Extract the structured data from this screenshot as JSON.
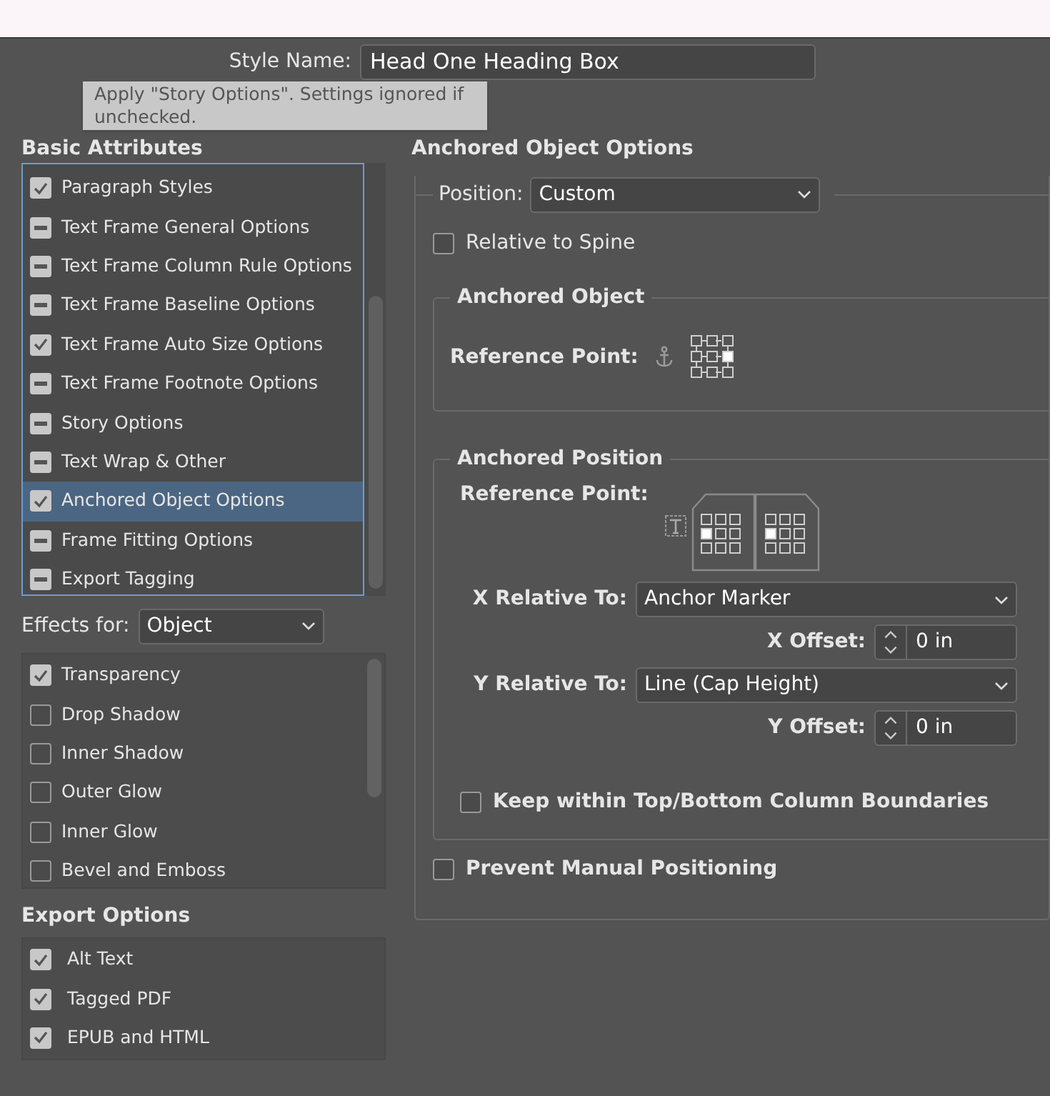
{
  "style_name": {
    "label": "Style Name:",
    "value": "Head One Heading Box"
  },
  "tooltip": "Apply \"Story Options\". Settings ignored if unchecked.",
  "basic_attributes": {
    "title": "Basic Attributes",
    "items": [
      {
        "label": "Paragraph Styles",
        "checked": true,
        "mixed": false,
        "selected": false
      },
      {
        "label": "Text Frame General Options",
        "checked": false,
        "mixed": true,
        "selected": false
      },
      {
        "label": "Text Frame Column Rule Options",
        "checked": false,
        "mixed": true,
        "selected": false
      },
      {
        "label": "Text Frame Baseline Options",
        "checked": false,
        "mixed": true,
        "selected": false
      },
      {
        "label": "Text Frame Auto Size Options",
        "checked": true,
        "mixed": false,
        "selected": false
      },
      {
        "label": "Text Frame Footnote Options",
        "checked": false,
        "mixed": true,
        "selected": false
      },
      {
        "label": "Story Options",
        "checked": false,
        "mixed": true,
        "selected": false
      },
      {
        "label": "Text Wrap & Other",
        "checked": false,
        "mixed": true,
        "selected": false
      },
      {
        "label": "Anchored Object Options",
        "checked": true,
        "mixed": false,
        "selected": true
      },
      {
        "label": "Frame Fitting Options",
        "checked": false,
        "mixed": true,
        "selected": false
      },
      {
        "label": "Export Tagging",
        "checked": false,
        "mixed": true,
        "selected": false
      }
    ]
  },
  "effects_for": {
    "label": "Effects for:",
    "value": "Object"
  },
  "effects": [
    {
      "label": "Transparency",
      "checked": true
    },
    {
      "label": "Drop Shadow",
      "checked": false
    },
    {
      "label": "Inner Shadow",
      "checked": false
    },
    {
      "label": "Outer Glow",
      "checked": false
    },
    {
      "label": "Inner Glow",
      "checked": false
    },
    {
      "label": "Bevel and Emboss",
      "checked": false
    }
  ],
  "export_options": {
    "title": "Export Options",
    "items": [
      {
        "label": "Alt Text",
        "checked": true
      },
      {
        "label": "Tagged PDF",
        "checked": true
      },
      {
        "label": "EPUB and HTML",
        "checked": true
      }
    ]
  },
  "anchored_object_options": {
    "title": "Anchored Object Options",
    "position": {
      "label": "Position:",
      "value": "Custom"
    },
    "relative_to_spine": {
      "label": "Relative to Spine",
      "checked": false
    },
    "anchored_object": {
      "title": "Anchored Object",
      "reference_label": "Reference Point:",
      "points": [
        {
          "selected": false
        },
        {
          "selected": false
        },
        {
          "selected": false
        },
        {
          "selected": false
        },
        {
          "selected": false
        },
        {
          "selected": true
        },
        {
          "selected": false
        },
        {
          "selected": false
        },
        {
          "selected": false
        }
      ]
    },
    "anchored_position": {
      "title": "Anchored Position",
      "reference_label": "Reference Point:",
      "points": [
        {
          "selected": false
        },
        {
          "selected": false
        },
        {
          "selected": false
        },
        {
          "selected": true
        },
        {
          "selected": false
        },
        {
          "selected": false
        },
        {
          "selected": false
        },
        {
          "selected": false
        },
        {
          "selected": false
        }
      ],
      "x_relative": {
        "label": "X Relative To:",
        "value": "Anchor Marker"
      },
      "x_offset": {
        "label": "X Offset:",
        "value": "0 in"
      },
      "y_relative": {
        "label": "Y Relative To:",
        "value": "Line (Cap Height)"
      },
      "y_offset": {
        "label": "Y Offset:",
        "value": "0 in"
      },
      "keep_within": {
        "label": "Keep within Top/Bottom Column Boundaries",
        "checked": false
      }
    },
    "prevent_manual": {
      "label": "Prevent Manual Positioning",
      "checked": false
    }
  }
}
